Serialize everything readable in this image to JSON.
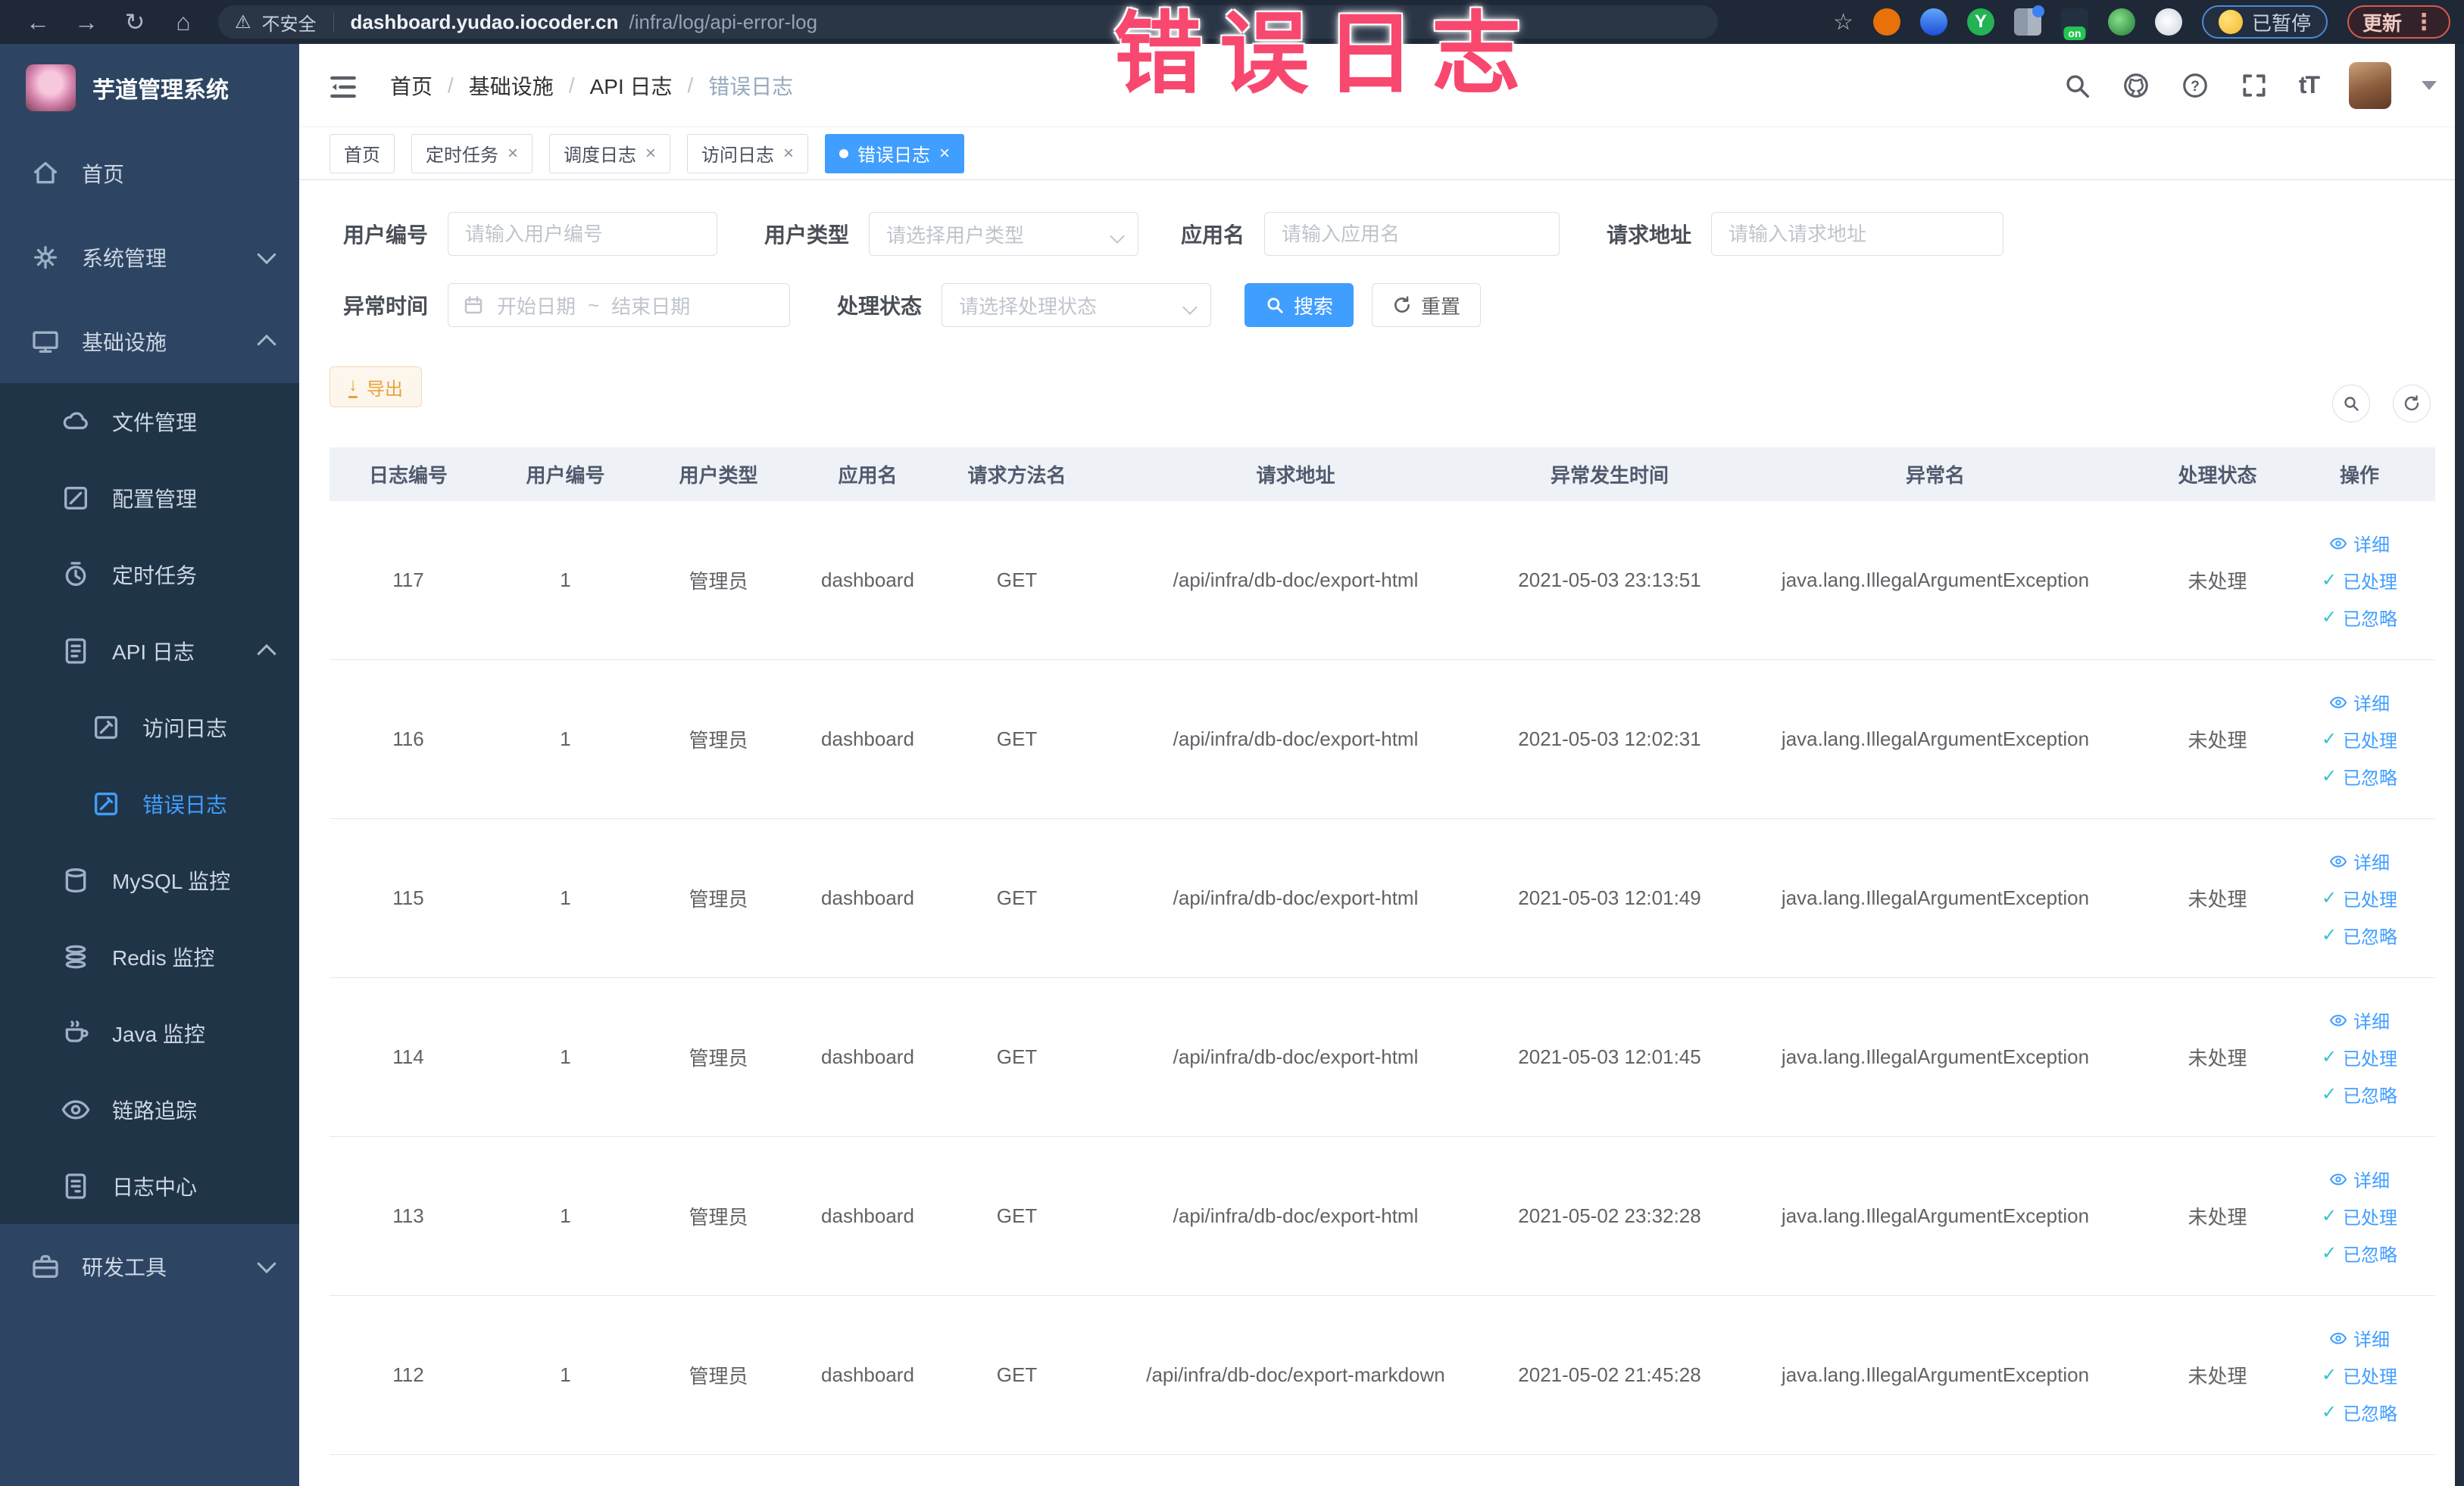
{
  "colors": {
    "accent": "#409eff",
    "warning": "#e6a23c",
    "annotation": "#f8486f",
    "sidebar_bg": "#2d4563",
    "submenu_bg": "#203448"
  },
  "icons": {
    "back": "←",
    "forward": "→",
    "reload": "↻",
    "home": "⌂",
    "warning": "⚠",
    "star": "☆",
    "kebab": "⋮",
    "check": "✓",
    "question": "?",
    "fontsize": "tT",
    "ext_letter_y": "Y",
    "on_badge": "on"
  },
  "annotation": {
    "text": "错误日志"
  },
  "browser": {
    "security_label": "不安全",
    "url_host": "dashboard.yudao.iocoder.cn",
    "url_path": "/infra/log/api-error-log",
    "paused_label": "已暂停",
    "update_label": "更新"
  },
  "sidebar": {
    "brand": "芋道管理系统",
    "items": [
      {
        "label": "首页",
        "icon": "home-icon"
      },
      {
        "label": "系统管理",
        "icon": "gear-icon"
      },
      {
        "label": "基础设施",
        "icon": "monitor-icon"
      },
      {
        "label": "文件管理",
        "icon": "cloud-icon"
      },
      {
        "label": "配置管理",
        "icon": "edit-icon"
      },
      {
        "label": "定时任务",
        "icon": "timer-icon"
      },
      {
        "label": "API 日志",
        "icon": "api-log-icon"
      },
      {
        "label": "访问日志",
        "icon": "doc-edit-icon"
      },
      {
        "label": "错误日志",
        "icon": "doc-edit-icon"
      },
      {
        "label": "MySQL 监控",
        "icon": "mysql-icon"
      },
      {
        "label": "Redis 监控",
        "icon": "redis-icon"
      },
      {
        "label": "Java 监控",
        "icon": "java-icon"
      },
      {
        "label": "链路追踪",
        "icon": "trace-eye-icon"
      },
      {
        "label": "日志中心",
        "icon": "log-center-icon"
      },
      {
        "label": "研发工具",
        "icon": "briefcase-icon"
      }
    ]
  },
  "header": {
    "breadcrumb": {
      "items": [
        "首页",
        "基础设施",
        "API 日志",
        "错误日志"
      ],
      "separator": "/"
    }
  },
  "tabs": {
    "close_glyph": "×",
    "items": [
      {
        "label": "首页"
      },
      {
        "label": "定时任务"
      },
      {
        "label": "调度日志"
      },
      {
        "label": "访问日志"
      },
      {
        "label": "错误日志"
      }
    ]
  },
  "filters": {
    "user_id": {
      "label": "用户编号",
      "placeholder": "请输入用户编号"
    },
    "user_type": {
      "label": "用户类型",
      "placeholder": "请选择用户类型"
    },
    "app_name": {
      "label": "应用名",
      "placeholder": "请输入应用名"
    },
    "request_url": {
      "label": "请求地址",
      "placeholder": "请输入请求地址"
    },
    "exception_time": {
      "label": "异常时间",
      "start_placeholder": "开始日期",
      "separator": "~",
      "end_placeholder": "结束日期"
    },
    "process_status": {
      "label": "处理状态",
      "placeholder": "请选择处理状态"
    },
    "search_label": "搜索",
    "reset_label": "重置"
  },
  "toolbar": {
    "export_label": "导出"
  },
  "table": {
    "columns": [
      "日志编号",
      "用户编号",
      "用户类型",
      "应用名",
      "请求方法名",
      "请求地址",
      "异常发生时间",
      "异常名",
      "处理状态",
      "操作"
    ],
    "action_labels": {
      "detail": "详细",
      "processed": "已处理",
      "ignored": "已忽略"
    },
    "rows": [
      {
        "id": "117",
        "user_id": "1",
        "user_type": "管理员",
        "app": "dashboard",
        "method": "GET",
        "url": "/api/infra/db-doc/export-html",
        "time": "2021-05-03 23:13:51",
        "exception": "java.lang.IllegalArgumentException",
        "status": "未处理"
      },
      {
        "id": "116",
        "user_id": "1",
        "user_type": "管理员",
        "app": "dashboard",
        "method": "GET",
        "url": "/api/infra/db-doc/export-html",
        "time": "2021-05-03 12:02:31",
        "exception": "java.lang.IllegalArgumentException",
        "status": "未处理"
      },
      {
        "id": "115",
        "user_id": "1",
        "user_type": "管理员",
        "app": "dashboard",
        "method": "GET",
        "url": "/api/infra/db-doc/export-html",
        "time": "2021-05-03 12:01:49",
        "exception": "java.lang.IllegalArgumentException",
        "status": "未处理"
      },
      {
        "id": "114",
        "user_id": "1",
        "user_type": "管理员",
        "app": "dashboard",
        "method": "GET",
        "url": "/api/infra/db-doc/export-html",
        "time": "2021-05-03 12:01:45",
        "exception": "java.lang.IllegalArgumentException",
        "status": "未处理"
      },
      {
        "id": "113",
        "user_id": "1",
        "user_type": "管理员",
        "app": "dashboard",
        "method": "GET",
        "url": "/api/infra/db-doc/export-html",
        "time": "2021-05-02 23:32:28",
        "exception": "java.lang.IllegalArgumentException",
        "status": "未处理"
      },
      {
        "id": "112",
        "user_id": "1",
        "user_type": "管理员",
        "app": "dashboard",
        "method": "GET",
        "url": "/api/infra/db-doc/export-markdown",
        "time": "2021-05-02 21:45:28",
        "exception": "java.lang.IllegalArgumentException",
        "status": "未处理"
      }
    ]
  }
}
